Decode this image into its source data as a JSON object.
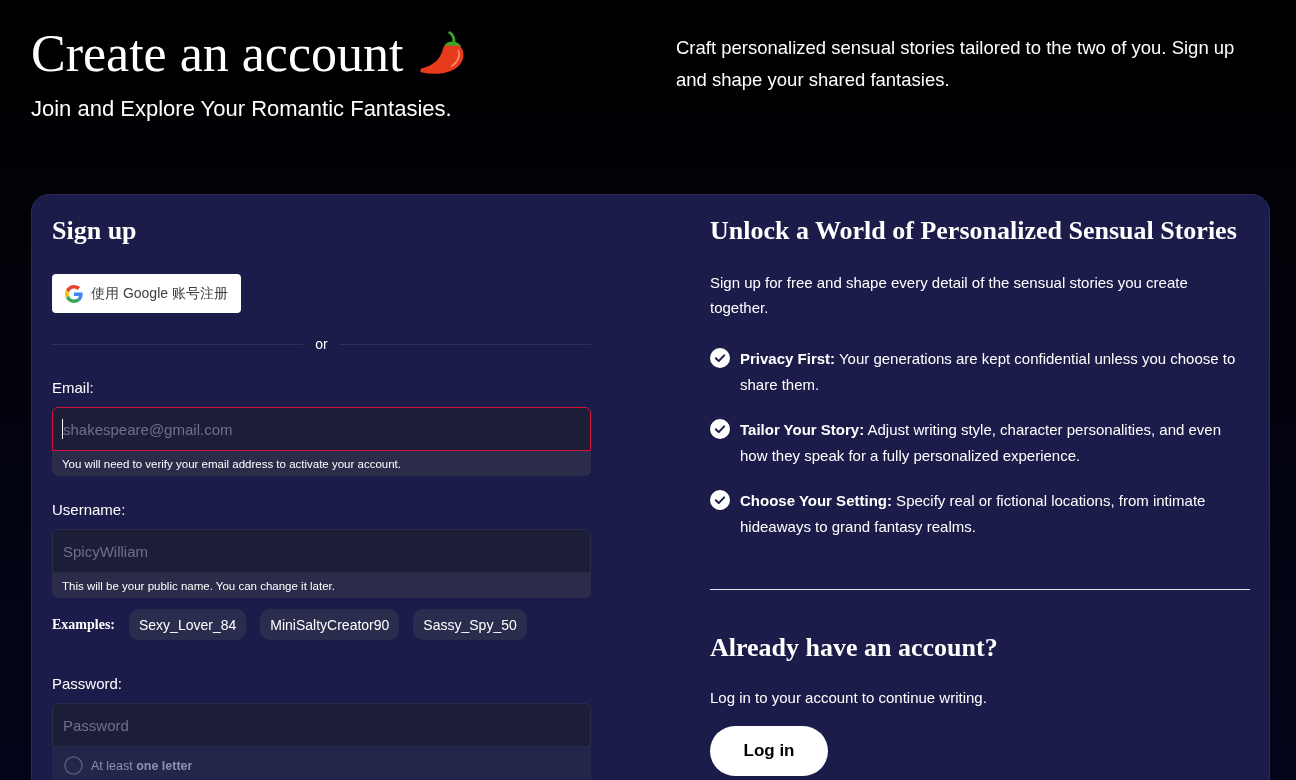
{
  "header": {
    "title": "Create an account",
    "subtitle": "Join and Explore Your Romantic Fantasies.",
    "blurb": "Craft personalized sensual stories tailored to the two of you. Sign up and shape your shared fantasies."
  },
  "signup": {
    "heading": "Sign up",
    "google_button": "使用 Google 账号注册",
    "divider": "or",
    "fields": [
      {
        "label": "Email:",
        "placeholder": "shakespeare@gmail.com",
        "hint": "You will need to verify your email address to activate your account.",
        "invalid": true,
        "focused": true
      },
      {
        "label": "Username:",
        "placeholder": "SpicyWilliam",
        "hint": "This will be your public name. You can change it later.",
        "invalid": false,
        "focused": false
      }
    ],
    "examples": {
      "label": "Examples:",
      "items": [
        "Sexy_Lover_84",
        "MiniSaltyCreator90",
        "Sassy_Spy_50"
      ]
    },
    "password": {
      "label": "Password:",
      "placeholder": "Password",
      "requirements": [
        {
          "text": "At least **one letter**",
          "met": false
        }
      ]
    }
  },
  "promo": {
    "heading": "Unlock a World of Personalized Sensual Stories",
    "intro": "Sign up for free and shape every detail of the sensual stories you create together.",
    "features": [
      "**Privacy First:** Your generations are kept confidential unless you choose to share them.",
      "**Tailor Your Story:** Adjust writing style, character personalities, and even how they speak for a fully personalized experience.",
      "**Choose Your Setting:** Specify real or fictional locations, from intimate hideaways to grand fantasy realms."
    ],
    "login": {
      "heading": "Already have an account?",
      "text": "Log in to your account to continue writing.",
      "button": "Log in"
    }
  }
}
